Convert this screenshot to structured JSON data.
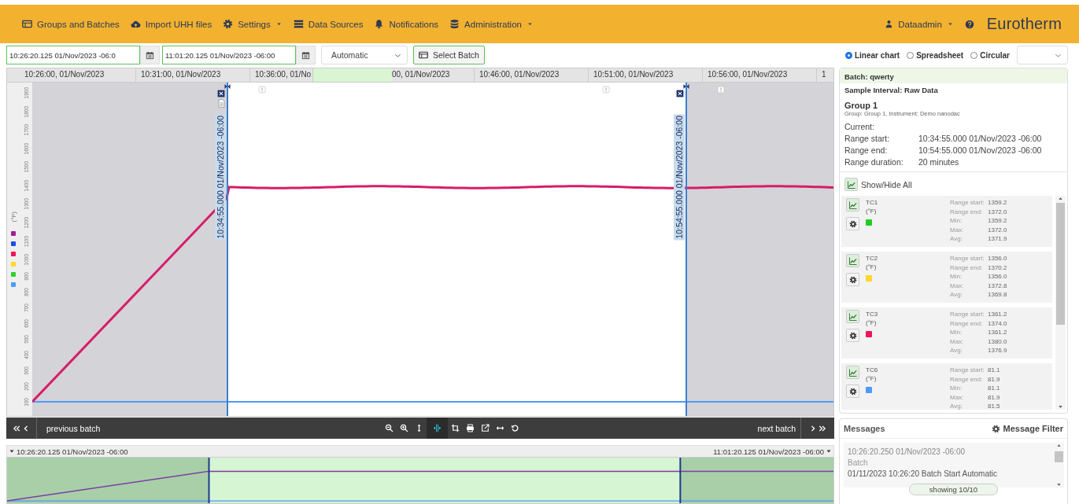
{
  "nav": {
    "items": [
      {
        "label": "Groups and Batches",
        "kind": "table",
        "dropdown": false
      },
      {
        "label": "Import UHH files",
        "kind": "cloud",
        "dropdown": false
      },
      {
        "label": "Settings",
        "kind": "gear",
        "dropdown": true
      },
      {
        "label": "Data Sources",
        "kind": "list",
        "dropdown": false
      },
      {
        "label": "Notifications",
        "kind": "bell",
        "dropdown": false
      },
      {
        "label": "Administration",
        "kind": "database",
        "dropdown": true
      }
    ],
    "user": "Dataadmin",
    "brand": "Eurotherm"
  },
  "toolbar": {
    "start": "10:26:20.125 01/Nov/2023 -06:0",
    "end": "11:01:20.125 01/Nov/2023 -06:00",
    "mode": "Automatic",
    "select_batch": "Select Batch",
    "views": [
      {
        "label": "Linear chart",
        "selected": true
      },
      {
        "label": "Spreadsheet",
        "selected": false
      },
      {
        "label": "Circular",
        "selected": false
      }
    ]
  },
  "chart": {
    "time_labels": [
      "10:26:00, 01/Nov/2023",
      "10:31:00, 01/Nov/2023",
      "10:36:00, 01/No",
      "00, 01/Nov/2023",
      "10:46:00, 01/Nov/2023",
      "10:51:00, 01/Nov/2023",
      "10:56:00, 01/Nov/2023",
      "1"
    ],
    "y_axis": {
      "unit": "(°F)",
      "ticks": [
        "1900",
        "1800",
        "1700",
        "1600",
        "1500",
        "1400",
        "1300",
        "1200",
        "1100",
        "1000",
        "900",
        "800",
        "700",
        "600",
        "500",
        "400",
        "300",
        "200",
        "100"
      ]
    },
    "legend": [
      {
        "color": "#a0208f"
      },
      {
        "color": "#1f4ee0"
      },
      {
        "color": "#f0145a"
      },
      {
        "color": "#ffd62a"
      },
      {
        "color": "#2ed12e"
      },
      {
        "color": "#4f9af5"
      }
    ],
    "cursors": [
      {
        "label": "10:34:55.000 01/Nov/2023 -06:00"
      },
      {
        "label": "10:54:55.000 01/Nov/2023 -06:00"
      }
    ]
  },
  "chartbar": {
    "previous": "previous batch",
    "next": "next batch",
    "tools": [
      {
        "kind": "zoom-out",
        "selected": false
      },
      {
        "kind": "zoom-in",
        "selected": false
      },
      {
        "kind": "vertical",
        "selected": false
      },
      {
        "kind": "cursors",
        "selected": true
      },
      {
        "kind": "crop",
        "selected": false
      },
      {
        "kind": "print",
        "selected": false
      },
      {
        "kind": "export",
        "selected": false
      },
      {
        "kind": "fit",
        "selected": false
      },
      {
        "kind": "reset",
        "selected": false
      }
    ]
  },
  "overview": {
    "start": "10:26:20.125 01/Nov/2023 -06:00",
    "end": "11:01:20.125 01/Nov/2023 -06:00"
  },
  "info": {
    "batch": "Batch: qwerty",
    "interval": "Sample Interval: Raw Data",
    "group": "Group 1",
    "group_detail": "Group: Group 1, Instrument: Demo nanodac",
    "current": "Current:",
    "ranges": [
      {
        "label": "Range start:",
        "value": "10:34:55.000 01/Nov/2023 -06:00"
      },
      {
        "label": "Range end:",
        "value": "10:54:55.000 01/Nov/2023 -06:00"
      },
      {
        "label": "Range duration:",
        "value": "20 minutes"
      }
    ],
    "show_hide": "Show/Hide All",
    "channels": [
      {
        "name": "TC1",
        "unit": "(°F)",
        "color": "#22cc22",
        "stats": [
          {
            "label": "Range start:",
            "value": "1359.2"
          },
          {
            "label": "Range end:",
            "value": "1372.0"
          },
          {
            "label": "Min:",
            "value": "1359.2"
          },
          {
            "label": "Max:",
            "value": "1372.0"
          },
          {
            "label": "Avg:",
            "value": "1371.9"
          }
        ]
      },
      {
        "name": "TC2",
        "unit": "(°F)",
        "color": "#ffd62a",
        "stats": [
          {
            "label": "Range start:",
            "value": "1356.0"
          },
          {
            "label": "Range end:",
            "value": "1370.2"
          },
          {
            "label": "Min:",
            "value": "1356.0"
          },
          {
            "label": "Max:",
            "value": "1372.8"
          },
          {
            "label": "Avg:",
            "value": "1369.8"
          }
        ]
      },
      {
        "name": "TC3",
        "unit": "(°F)",
        "color": "#f0145a",
        "stats": [
          {
            "label": "Range start:",
            "value": "1361.2"
          },
          {
            "label": "Range end:",
            "value": "1374.0"
          },
          {
            "label": "Min:",
            "value": "1361.2"
          },
          {
            "label": "Max:",
            "value": "1380.0"
          },
          {
            "label": "Avg:",
            "value": "1376.9"
          }
        ]
      },
      {
        "name": "TC6",
        "unit": "(°F)",
        "color": "#4f9af5",
        "stats": [
          {
            "label": "Range start:",
            "value": "81.1"
          },
          {
            "label": "Range end:",
            "value": "81.9"
          },
          {
            "label": "Min:",
            "value": "81.1"
          },
          {
            "label": "Max:",
            "value": "81.9"
          },
          {
            "label": "Avg:",
            "value": "81.5"
          }
        ]
      }
    ]
  },
  "messages": {
    "title": "Messages",
    "filter": "Message Filter",
    "items": [
      {
        "time": "10:26:20.250 01/Nov/2023 -06:00",
        "source": "Batch",
        "text": "01/11/2023 10:26:20 Batch Start Automatic"
      }
    ],
    "showing": "showing 10/10"
  }
}
